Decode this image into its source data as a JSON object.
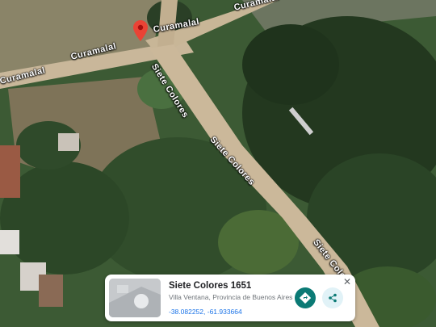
{
  "map": {
    "roads": [
      {
        "name": "Curamalal"
      },
      {
        "name": "Curamalal"
      },
      {
        "name": "Curamalal"
      },
      {
        "name": "Curamalal"
      },
      {
        "name": "Siete Colores"
      },
      {
        "name": "Siete Colores"
      },
      {
        "name": "Siete Colores"
      }
    ],
    "pin_color": "#ea4335"
  },
  "info_card": {
    "title": "Siete Colores 1651",
    "subtitle": "Villa Ventana, Provincia de Buenos Aires",
    "coordinates": "-38.082252, -61.933664",
    "directions_icon": "directions-icon",
    "share_icon": "share-icon",
    "close_label": "✕",
    "accent_color": "#0b7a75"
  }
}
